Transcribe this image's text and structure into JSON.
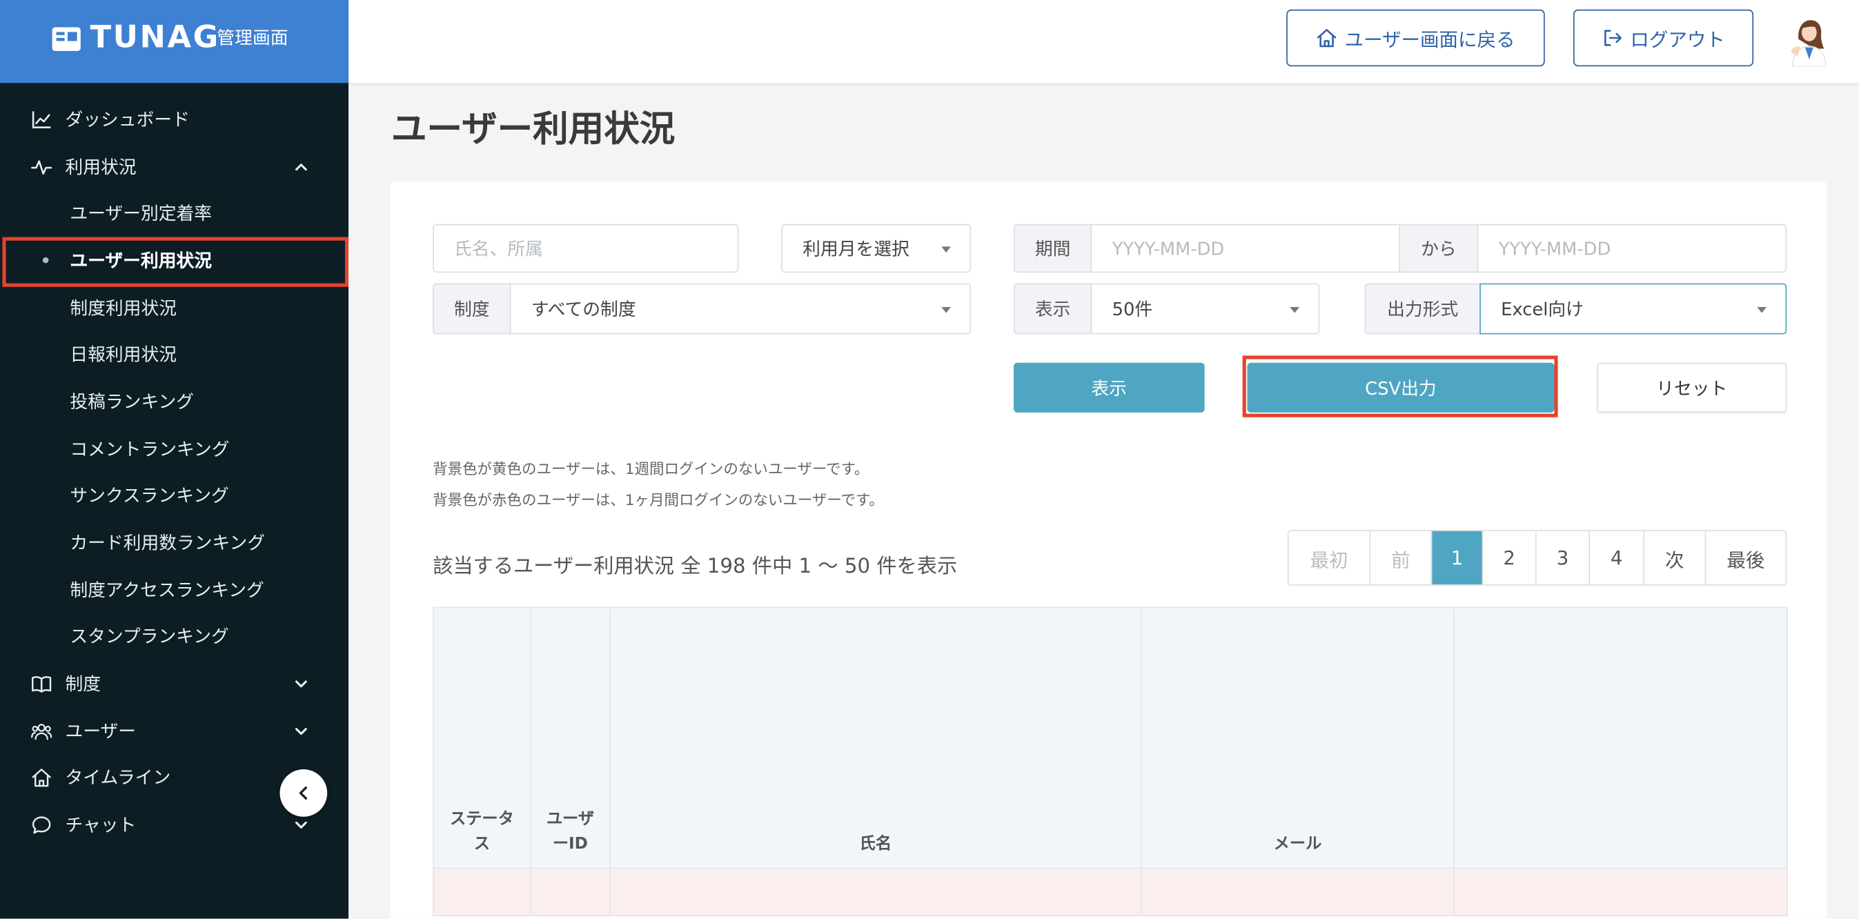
{
  "brand": {
    "logo_text": "TUNAG",
    "subtitle": "管理画面",
    "icon": "brand-card-icon"
  },
  "header": {
    "back_button": {
      "label": "ユーザー画面に戻る",
      "icon": "home-icon"
    },
    "logout_button": {
      "label": "ログアウト",
      "icon": "logout-icon"
    }
  },
  "sidebar": {
    "nav": [
      {
        "label": "ダッシュボード",
        "icon": "chart-line-icon"
      },
      {
        "label": "利用状況",
        "icon": "pulse-icon",
        "expanded": true,
        "active_child_index": 1,
        "children": [
          {
            "label": "ユーザー別定着率"
          },
          {
            "label": "ユーザー利用状況",
            "annotated": true
          },
          {
            "label": "制度利用状況"
          },
          {
            "label": "日報利用状況"
          },
          {
            "label": "投稿ランキング"
          },
          {
            "label": "コメントランキング"
          },
          {
            "label": "サンクスランキング"
          },
          {
            "label": "カード利用数ランキング"
          },
          {
            "label": "制度アクセスランキング"
          },
          {
            "label": "スタンプランキング"
          }
        ]
      },
      {
        "label": "制度",
        "icon": "book-icon",
        "expanded": false
      },
      {
        "label": "ユーザー",
        "icon": "users-icon",
        "expanded": false
      },
      {
        "label": "タイムライン",
        "icon": "home-icon"
      },
      {
        "label": "チャット",
        "icon": "chat-icon",
        "expanded": false
      }
    ],
    "collapse_icon": "chevron-left-icon"
  },
  "page": {
    "title": "ユーザー利用状況"
  },
  "filters": {
    "name_search": {
      "placeholder": "氏名、所属"
    },
    "month": {
      "value": "利用月を選択"
    },
    "period": {
      "label": "期間",
      "from_placeholder": "YYYY-MM-DD",
      "separator": "から",
      "to_placeholder": "YYYY-MM-DD"
    },
    "program": {
      "label": "制度",
      "value": "すべての制度"
    },
    "per_page": {
      "label": "表示",
      "value": "50件"
    },
    "format": {
      "label": "出力形式",
      "value": "Excel向け",
      "focused": true
    }
  },
  "actions": {
    "show": {
      "label": "表示"
    },
    "csv": {
      "label": "CSV出力",
      "annotated": true
    },
    "reset": {
      "label": "リセット"
    }
  },
  "notes": [
    "背景色が黄色のユーザーは、1週間ログインのないユーザーです。",
    "背景色が赤色のユーザーは、1ヶ月間ログインのないユーザーです。"
  ],
  "summary": "該当するユーザー利用状況 全 198 件中 1 〜 50 件を表示",
  "pagination": {
    "first": "最初",
    "prev": "前",
    "pages": [
      "1",
      "2",
      "3",
      "4"
    ],
    "current_page": 1,
    "next": "次",
    "last": "最後"
  },
  "table": {
    "columns": [
      "ステータス",
      "ユーザーID",
      "氏名",
      "メール"
    ]
  },
  "colors": {
    "brand_blue": "#3e80d2",
    "sidebar_bg": "#0c1e24",
    "accent_teal": "#4ea6c2",
    "annotation_red": "#e5432c",
    "page_bg": "#f2f4f6",
    "inactive_row_bg": "#fbeeee",
    "header_button_blue": "#2f63a6"
  }
}
